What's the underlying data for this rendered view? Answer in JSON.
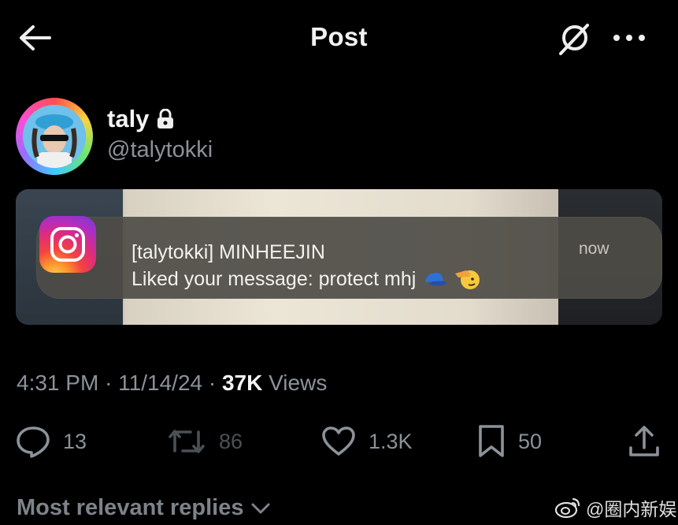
{
  "header": {
    "title": "Post",
    "back_icon": "arrow-left-icon",
    "grok_icon": "grok-icon",
    "more_icon": "more-horizontal-icon"
  },
  "author": {
    "display_name": "taly",
    "handle": "@talytokki",
    "protected_icon": "lock-icon"
  },
  "media": {
    "notification": {
      "app_icon": "instagram-icon",
      "title": "[talytokki] MINHEEJIN",
      "body": "Liked your message: protect mhj",
      "emojis": [
        "blue-cap-emoji",
        "saluting-face-emoji"
      ],
      "time": "now"
    }
  },
  "meta": {
    "time": "4:31 PM",
    "separator": "·",
    "date": "11/14/24",
    "views_count": "37K",
    "views_label": "Views"
  },
  "actions": {
    "replies": "13",
    "reposts": "86",
    "likes": "1.3K",
    "bookmarks": "50"
  },
  "replies_section": {
    "label": "Most relevant replies"
  },
  "watermark": {
    "text": "@圈内新娱",
    "icon": "weibo-icon"
  },
  "colors": {
    "background": "#000000",
    "primary_text": "#e7e9ea",
    "secondary_text": "#8b9299"
  }
}
